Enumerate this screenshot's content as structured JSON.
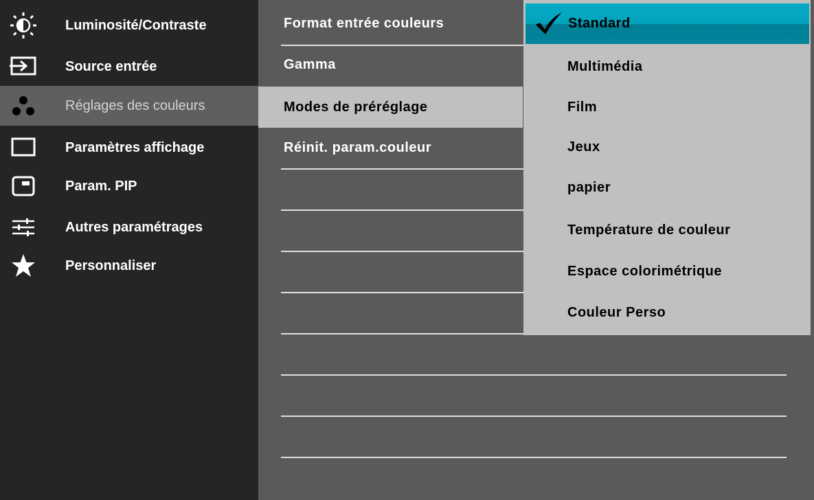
{
  "sidebar": {
    "items": [
      {
        "label": "Luminosité/Contraste",
        "icon": "brightness-icon"
      },
      {
        "label": "Source entrée",
        "icon": "input-source-icon"
      },
      {
        "label": "Réglages des couleurs",
        "icon": "color-dots-icon",
        "selected": true
      },
      {
        "label": "Paramètres affichage",
        "icon": "display-icon"
      },
      {
        "label": "Param. PIP",
        "icon": "pip-icon"
      },
      {
        "label": "Autres paramétrages",
        "icon": "sliders-icon"
      },
      {
        "label": "Personnaliser",
        "icon": "star-icon"
      }
    ]
  },
  "submenu": {
    "items": [
      {
        "label": "Format entrée couleurs"
      },
      {
        "label": "Gamma"
      },
      {
        "label": "Modes de préréglage",
        "selected": true
      },
      {
        "label": "Réinit. param.couleur"
      }
    ]
  },
  "options": {
    "items": [
      {
        "label": "Standard",
        "selected": true
      },
      {
        "label": "Multimédia"
      },
      {
        "label": "Film"
      },
      {
        "label": "Jeux"
      },
      {
        "label": "papier"
      },
      {
        "label": "Température de couleur"
      },
      {
        "label": "Espace colorimétrique"
      },
      {
        "label": "Couleur Perso"
      }
    ]
  },
  "colors": {
    "sidebar_bg": "#252525",
    "submenu_bg": "#5a5a5a",
    "selected_bg": "#c0c0c0",
    "accent": "#03a3bd"
  }
}
